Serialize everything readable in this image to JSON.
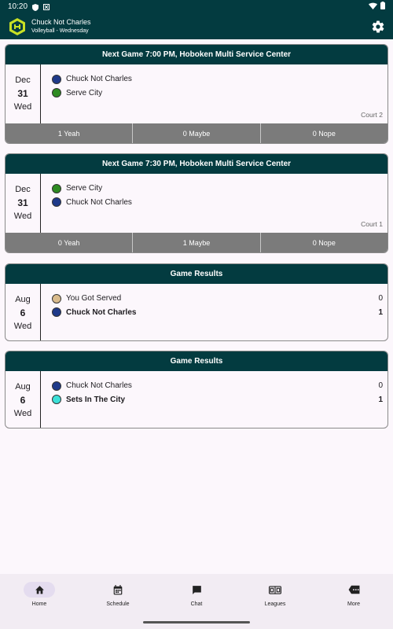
{
  "status_bar": {
    "time": "10:20"
  },
  "app_bar": {
    "title": "Chuck Not Charles",
    "subtitle": "Volleyball - Wednesday"
  },
  "cards": [
    {
      "header": "Next Game  7:00 PM, Hoboken Multi Service Center",
      "month": "Dec",
      "day": "31",
      "weekday": "Wed",
      "teams": [
        {
          "name": "Chuck Not Charles",
          "color": "#1f3a8a"
        },
        {
          "name": "Serve City",
          "color": "#2e8b22"
        }
      ],
      "court": "Court 2",
      "rsvp": {
        "yes": "1 Yeah",
        "maybe": "0 Maybe",
        "no": "0 Nope"
      }
    },
    {
      "header": "Next Game  7:30 PM, Hoboken Multi Service Center",
      "month": "Dec",
      "day": "31",
      "weekday": "Wed",
      "teams": [
        {
          "name": "Serve City",
          "color": "#2e8b22"
        },
        {
          "name": "Chuck Not Charles",
          "color": "#1f3a8a"
        }
      ],
      "court": "Court 1",
      "rsvp": {
        "yes": "0 Yeah",
        "maybe": "1 Maybe",
        "no": "0 Nope"
      }
    },
    {
      "header": "Game Results",
      "month": "Aug",
      "day": "6",
      "weekday": "Wed",
      "teams": [
        {
          "name": "You Got Served",
          "color": "#d9bb8c",
          "score": "0"
        },
        {
          "name": "Chuck Not Charles",
          "color": "#1f3a8a",
          "score": "1",
          "winner": true
        }
      ]
    },
    {
      "header": "Game Results",
      "month": "Aug",
      "day": "6",
      "weekday": "Wed",
      "teams": [
        {
          "name": "Chuck Not Charles",
          "color": "#1f3a8a",
          "score": "0"
        },
        {
          "name": "Sets In The City",
          "color": "#3ce0d8",
          "score": "1",
          "winner": true
        }
      ]
    }
  ],
  "nav": [
    {
      "label": "Home",
      "icon": "home-icon",
      "active": true
    },
    {
      "label": "Schedule",
      "icon": "calendar-icon"
    },
    {
      "label": "Chat",
      "icon": "chat-icon"
    },
    {
      "label": "Leagues",
      "icon": "scoreboard-icon"
    },
    {
      "label": "More",
      "icon": "more-icon"
    }
  ],
  "colors": {
    "header": "#033b40",
    "rsvp_bg": "#7b7b7b",
    "background": "#fcf7fc"
  }
}
